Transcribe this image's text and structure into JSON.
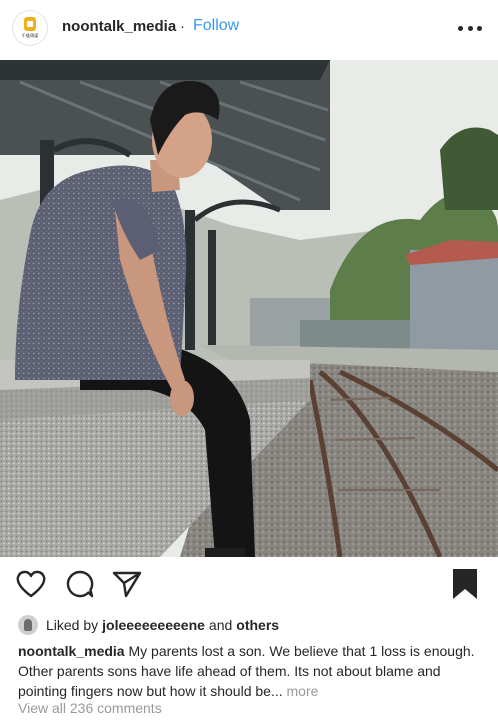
{
  "header": {
    "username": "noontalk_media",
    "separator": "·",
    "follow_label": "Follow",
    "avatar_text": "千禧傳媒"
  },
  "photo": {
    "icon": "photo-of-young-man-sitting-on-train-platform"
  },
  "actions": {
    "like_icon": "heart-outline-icon",
    "comment_icon": "comment-bubble-icon",
    "share_icon": "paper-plane-icon",
    "save_icon": "bookmark-filled-icon"
  },
  "likes": {
    "prefix": "Liked by",
    "first_user": "joleeeeeeeeene",
    "joiner": "and",
    "others": "others"
  },
  "caption": {
    "username": "noontalk_media",
    "text": "My parents lost a son. We believe that 1 loss is enough. Other parents sons have life ahead of them. Its not about blame and pointing fingers now but how it should be...",
    "more_label": "more"
  },
  "comments": {
    "view_all_label": "View all 236 comments"
  },
  "colors": {
    "accent": "#3897f0",
    "text": "#262626",
    "muted": "#999999"
  }
}
